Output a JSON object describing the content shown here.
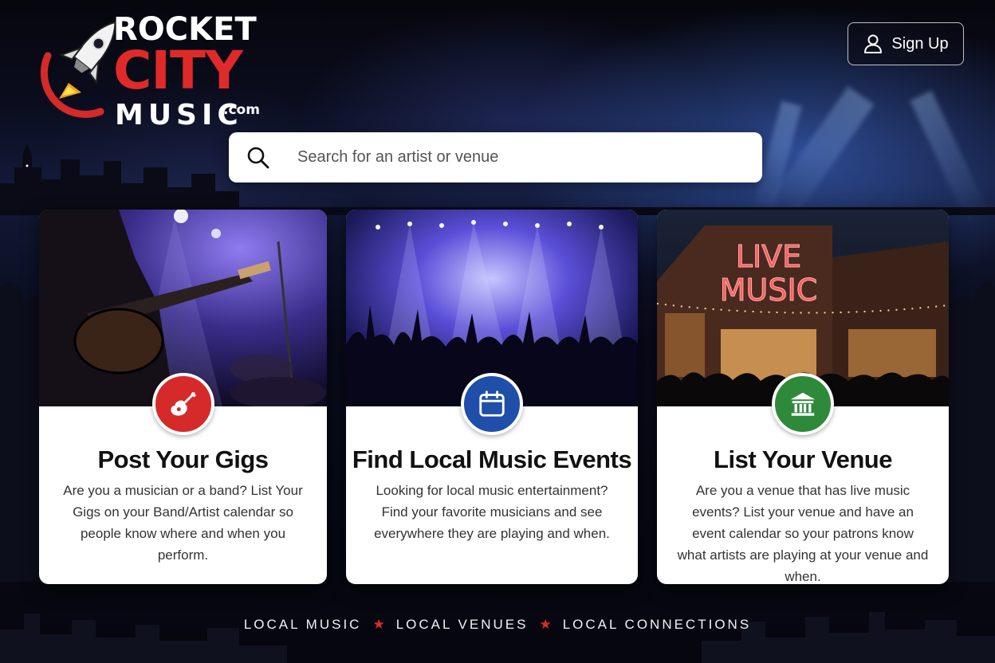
{
  "brand": {
    "line1": "ROCKET",
    "line2": "CITY",
    "line3": "MUSIC",
    "suffix": ".com",
    "colors": {
      "accent_red": "#e02a2a",
      "white": "#ffffff"
    }
  },
  "header": {
    "signup_label": "Sign Up",
    "signup_icon": "user-icon"
  },
  "search": {
    "placeholder": "Search for an artist or venue",
    "value": "",
    "icon": "search-icon"
  },
  "cards": [
    {
      "title": "Post Your Gigs",
      "description": "Are you a musician or a band? List Your Gigs on your Band/Artist calendar so people know where and when you perform.",
      "icon": "guitar-icon",
      "badge_color": "#d42a2a"
    },
    {
      "title": "Find Local Music Events",
      "description": "Looking for local music entertainment? Find your favorite musicians and see everywhere they are playing and when.",
      "icon": "calendar-icon",
      "badge_color": "#1f4fa8"
    },
    {
      "title": "List Your Venue",
      "description": "Are you a venue that has live music events? List your venue and have an event calendar so your patrons know what artists are playing at your venue and when.",
      "icon": "venue-building-icon",
      "badge_color": "#2e8a3a",
      "photo_sign": [
        "LIVE",
        "MUSIC"
      ]
    }
  ],
  "footer": {
    "tagline": [
      "LOCAL MUSIC",
      "LOCAL VENUES",
      "LOCAL CONNECTIONS"
    ],
    "separator": "★"
  }
}
